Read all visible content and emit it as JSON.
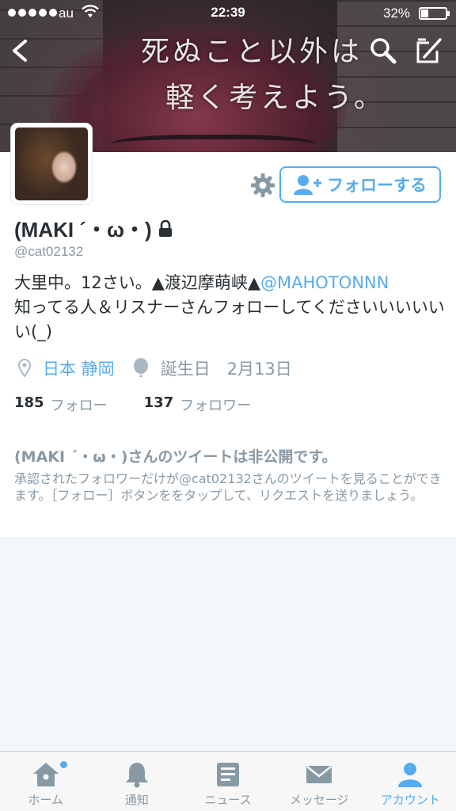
{
  "status_bar": {
    "carrier": "au",
    "time": "22:39",
    "battery": "32%"
  },
  "header": {
    "overlay_line1": "死ぬこと以外は",
    "overlay_line2": "軽く考えよう。"
  },
  "profile": {
    "follow_button": "フォローする",
    "name": "(MAKI ´・ω・)",
    "handle": "@cat02132",
    "bio_text": "大里中。12さい。▲渡辺摩萌峡▲",
    "bio_mention": "@MAHOTONNN",
    "bio_text2": "知ってる人＆リスナーさんフォローしてくださいいいいいい(_)",
    "location": "日本 静岡",
    "birthday": "誕生日　2月13日",
    "following_count": "185",
    "following_label": "フォロー",
    "followers_count": "137",
    "followers_label": "フォロワー"
  },
  "protected": {
    "title": "(MAKI ´・ω・)さんのツイートは非公開です。",
    "description": "承認されたフォロワーだけが@cat02132さんのツイートを見ることができます。［フォロー］ボタンををタップして、リクエストを送りましょう。"
  },
  "tabbar": {
    "items": [
      {
        "label": "ホーム",
        "icon": "home-icon"
      },
      {
        "label": "通知",
        "icon": "bell-icon"
      },
      {
        "label": "ニュース",
        "icon": "news-icon"
      },
      {
        "label": "メッセージ",
        "icon": "envelope-icon"
      },
      {
        "label": "アカウント",
        "icon": "person-icon"
      }
    ],
    "active": "アカウント"
  },
  "colors": {
    "accent": "#55acee",
    "muted": "#8899a6",
    "text": "#292f33"
  }
}
